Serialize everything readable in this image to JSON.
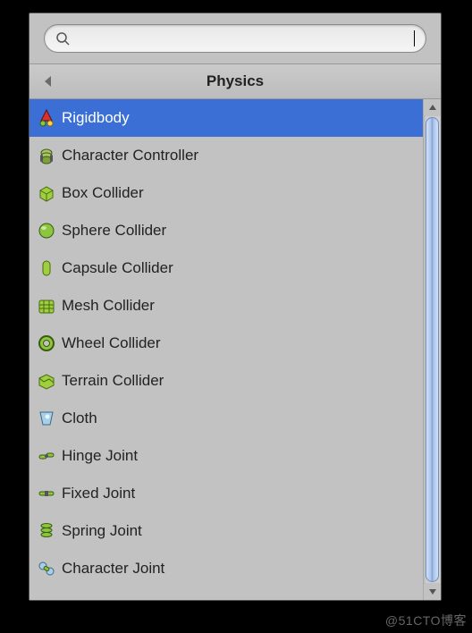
{
  "search": {
    "value": "",
    "placeholder": ""
  },
  "header": {
    "title": "Physics"
  },
  "items": [
    {
      "id": "rigidbody",
      "label": "Rigidbody",
      "icon": "rigidbody-icon",
      "selected": true
    },
    {
      "id": "character-controller",
      "label": "Character Controller",
      "icon": "character-controller-icon",
      "selected": false
    },
    {
      "id": "box-collider",
      "label": "Box Collider",
      "icon": "box-collider-icon",
      "selected": false
    },
    {
      "id": "sphere-collider",
      "label": "Sphere Collider",
      "icon": "sphere-collider-icon",
      "selected": false
    },
    {
      "id": "capsule-collider",
      "label": "Capsule Collider",
      "icon": "capsule-collider-icon",
      "selected": false
    },
    {
      "id": "mesh-collider",
      "label": "Mesh Collider",
      "icon": "mesh-collider-icon",
      "selected": false
    },
    {
      "id": "wheel-collider",
      "label": "Wheel Collider",
      "icon": "wheel-collider-icon",
      "selected": false
    },
    {
      "id": "terrain-collider",
      "label": "Terrain Collider",
      "icon": "terrain-collider-icon",
      "selected": false
    },
    {
      "id": "cloth",
      "label": "Cloth",
      "icon": "cloth-icon",
      "selected": false
    },
    {
      "id": "hinge-joint",
      "label": "Hinge Joint",
      "icon": "hinge-joint-icon",
      "selected": false
    },
    {
      "id": "fixed-joint",
      "label": "Fixed Joint",
      "icon": "fixed-joint-icon",
      "selected": false
    },
    {
      "id": "spring-joint",
      "label": "Spring Joint",
      "icon": "spring-joint-icon",
      "selected": false
    },
    {
      "id": "character-joint",
      "label": "Character Joint",
      "icon": "character-joint-icon",
      "selected": false
    }
  ],
  "watermark": "@51CTO博客",
  "colors": {
    "selectedBg": "#3b6fd6",
    "panelBg": "#c2c2c2"
  }
}
